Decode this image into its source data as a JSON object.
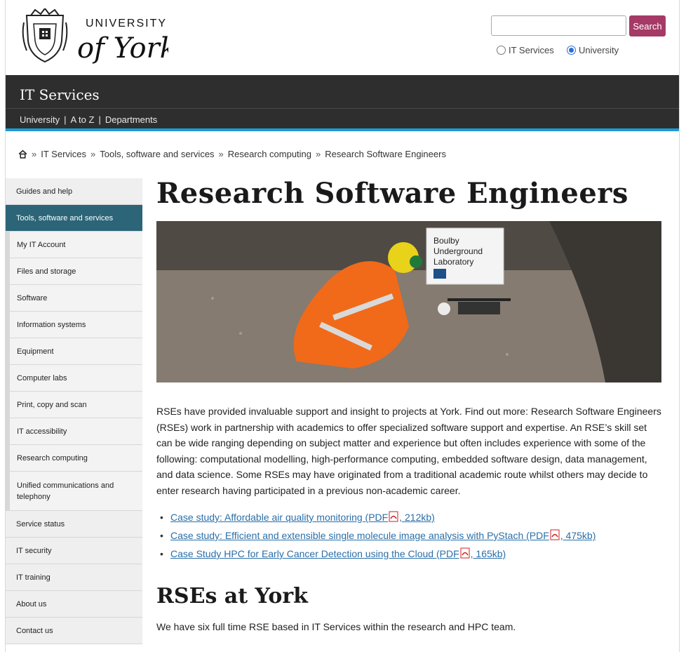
{
  "header": {
    "logo_text_top": "UNIVERSITY",
    "logo_text_main": "of York",
    "search_placeholder": "",
    "search_button": "Search",
    "scope_it": "IT Services",
    "scope_university": "University",
    "scope_selected": "University"
  },
  "banner": {
    "title": "IT Services",
    "links": [
      "University",
      "A to Z",
      "Departments"
    ],
    "separator": "|"
  },
  "breadcrumb": {
    "items": [
      "IT Services",
      "Tools, software and services",
      "Research computing",
      "Research Software Engineers"
    ],
    "separator": "»"
  },
  "sidebar": {
    "items": [
      {
        "label": "Guides and help"
      },
      {
        "label": "Tools, software and services"
      },
      {
        "label": "My IT Account"
      },
      {
        "label": "Files and storage"
      },
      {
        "label": "Software"
      },
      {
        "label": "Information systems"
      },
      {
        "label": "Equipment"
      },
      {
        "label": "Computer labs"
      },
      {
        "label": "Print, copy and scan"
      },
      {
        "label": "IT accessibility"
      },
      {
        "label": "Research computing"
      },
      {
        "label": "Unified communications and telephony"
      },
      {
        "label": "Service status"
      },
      {
        "label": "IT security"
      },
      {
        "label": "IT training"
      },
      {
        "label": "About us"
      },
      {
        "label": "Contact us"
      }
    ]
  },
  "main": {
    "title": "Research Software Engineers",
    "hero_sign": [
      "Boulby",
      "Underground",
      "Laboratory"
    ],
    "paragraph": "RSEs have provided invaluable support and insight to projects at York. Find out more: Research Software Engineers (RSEs) work in partnership with academics to offer specialized software support and expertise. An RSE’s skill set can be wide ranging depending on subject matter and experience but often includes experience with some of the following: computational modelling, high-performance computing, embedded software design, data management, and data science. Some RSEs may have originated from a traditional academic route whilst others may decide to enter research having participated in a previous non-academic career.",
    "links": [
      {
        "text": "Case study: Affordable air quality monitoring (PDF",
        "size": ", 212kb)"
      },
      {
        "text": "Case study: Efficient and extensible single molecule image analysis with PyStach (PDF",
        "size": ", 475kb)"
      },
      {
        "text": "Case Study HPC for Early Cancer Detection using the Cloud (PDF",
        "size": ", 165kb)"
      }
    ],
    "section_title": "RSEs at York",
    "section_text": "We have six full time RSE based in IT Services within the research and HPC team."
  },
  "colors": {
    "banner": "#2e2e2e",
    "accent": "#1f9bd6",
    "active_nav": "#2b6577",
    "search_button": "#a63a66",
    "link": "#2a6fa8"
  }
}
